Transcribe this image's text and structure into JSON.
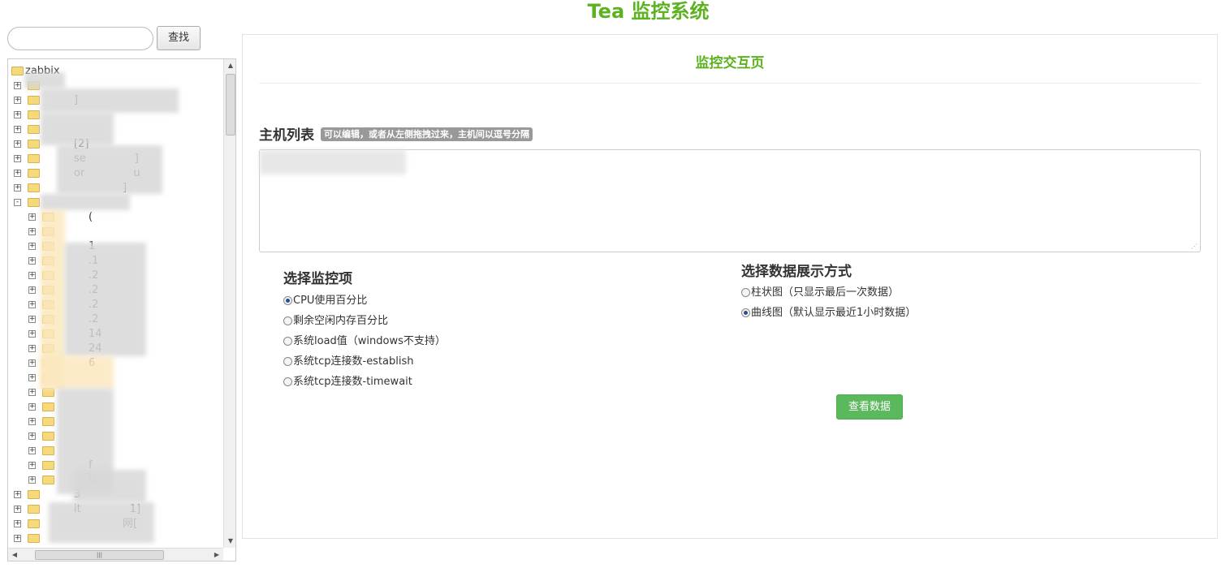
{
  "app": {
    "title": "Tea 监控系统"
  },
  "search": {
    "placeholder": "",
    "button_label": "查找"
  },
  "tree": {
    "root_label": "zabbix",
    "rows": [
      {
        "label": "",
        "expander": "+"
      },
      {
        "label": "]",
        "expander": "+"
      },
      {
        "label": "",
        "expander": "+"
      },
      {
        "label": "",
        "expander": "+"
      },
      {
        "label": "[2]",
        "expander": "+"
      },
      {
        "label": "se",
        "suffix": "]",
        "expander": "+"
      },
      {
        "label": "or",
        "suffix": "u",
        "expander": "+"
      },
      {
        "label": "",
        "suffix": "]",
        "expander": "+"
      },
      {
        "label": "",
        "expander": "-"
      },
      {
        "label": "(",
        "expander": "+"
      },
      {
        "label": "",
        "expander": "+"
      },
      {
        "label": "1",
        "expander": "+"
      },
      {
        "label": ".1",
        "expander": "+"
      },
      {
        "label": ".2",
        "expander": "+"
      },
      {
        "label": ".2",
        "expander": "+"
      },
      {
        "label": ".2",
        "expander": "+"
      },
      {
        "label": ".2",
        "expander": "+"
      },
      {
        "label": "14",
        "expander": "+"
      },
      {
        "label": "24",
        "expander": "+"
      },
      {
        "label": "6",
        "expander": "+"
      },
      {
        "label": "",
        "expander": "+"
      },
      {
        "label": "",
        "expander": "+"
      },
      {
        "label": "",
        "expander": "+"
      },
      {
        "label": "",
        "expander": "+"
      },
      {
        "label": "",
        "expander": "+"
      },
      {
        "label": "",
        "expander": "+"
      },
      {
        "label": "f",
        "expander": "+"
      },
      {
        "label": "0.",
        "expander": "+"
      },
      {
        "label": "3",
        "expander": "+"
      },
      {
        "label": "it",
        "suffix": "1]",
        "expander": "+"
      },
      {
        "label": "",
        "suffix": "网[",
        "expander": "+"
      },
      {
        "label": "",
        "expander": "+"
      }
    ]
  },
  "main": {
    "page_title": "监控交互页",
    "host_list_label": "主机列表",
    "host_list_hint": "可以编辑，或者从左侧拖拽过来，主机间以逗号分隔",
    "host_list_value": "",
    "metric_section_title": "选择监控项",
    "metrics": [
      {
        "label": "CPU使用百分比",
        "selected": true
      },
      {
        "label": "剩余空闲内存百分比",
        "selected": false
      },
      {
        "label": "系统load值（windows不支持）",
        "selected": false
      },
      {
        "label": "系统tcp连接数-establish",
        "selected": false
      },
      {
        "label": "系统tcp连接数-timewait",
        "selected": false
      }
    ],
    "display_section_title": "选择数据展示方式",
    "display_modes": [
      {
        "label": "柱状图（只显示最后一次数据）",
        "selected": false
      },
      {
        "label": "曲线图（默认显示最近1小时数据）",
        "selected": true
      }
    ],
    "view_button_label": "查看数据"
  },
  "colors": {
    "brand_green": "#5cb21f",
    "button_green": "#5cb85c",
    "hint_gray": "#999999"
  }
}
